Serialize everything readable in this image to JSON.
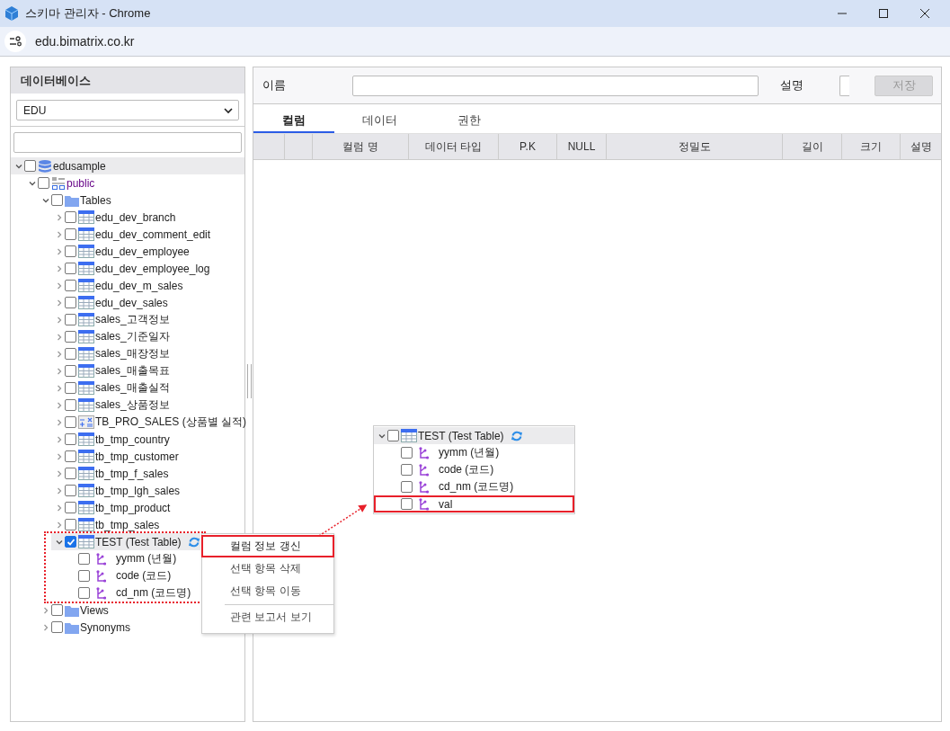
{
  "window": {
    "title": "스키마 관리자 - Chrome",
    "url": "edu.bimatrix.co.kr"
  },
  "sidebar": {
    "heading": "데이터베이스",
    "database_select": {
      "value": "EDU"
    },
    "tree": [
      {
        "label": "edusample",
        "kind": "database",
        "expanded": true,
        "checked": false,
        "highlighted": true,
        "children": [
          {
            "label": "public",
            "kind": "schema",
            "expanded": true,
            "checked": false,
            "highlighted": false,
            "children": [
              {
                "label": "Tables",
                "kind": "folder",
                "expanded": true,
                "checked": false,
                "highlighted": false,
                "children": [
                  {
                    "label": "edu_dev_branch",
                    "kind": "table",
                    "expanded": false,
                    "checked": false,
                    "highlighted": false
                  },
                  {
                    "label": "edu_dev_comment_edit",
                    "kind": "table",
                    "expanded": false,
                    "checked": false,
                    "highlighted": false
                  },
                  {
                    "label": "edu_dev_employee",
                    "kind": "table",
                    "expanded": false,
                    "checked": false,
                    "highlighted": false
                  },
                  {
                    "label": "edu_dev_employee_log",
                    "kind": "table",
                    "expanded": false,
                    "checked": false,
                    "highlighted": false
                  },
                  {
                    "label": "edu_dev_m_sales",
                    "kind": "table",
                    "expanded": false,
                    "checked": false,
                    "highlighted": false
                  },
                  {
                    "label": "edu_dev_sales",
                    "kind": "table",
                    "expanded": false,
                    "checked": false,
                    "highlighted": false
                  },
                  {
                    "label": "sales_고객정보",
                    "kind": "table",
                    "expanded": false,
                    "checked": false,
                    "highlighted": false
                  },
                  {
                    "label": "sales_기준일자",
                    "kind": "table",
                    "expanded": false,
                    "checked": false,
                    "highlighted": false
                  },
                  {
                    "label": "sales_매장정보",
                    "kind": "table",
                    "expanded": false,
                    "checked": false,
                    "highlighted": false
                  },
                  {
                    "label": "sales_매출목표",
                    "kind": "table",
                    "expanded": false,
                    "checked": false,
                    "highlighted": false
                  },
                  {
                    "label": "sales_매출실적",
                    "kind": "table",
                    "expanded": false,
                    "checked": false,
                    "highlighted": false
                  },
                  {
                    "label": "sales_상품정보",
                    "kind": "table",
                    "expanded": false,
                    "checked": false,
                    "highlighted": false
                  },
                  {
                    "label": "TB_PRO_SALES (상품별 실적)",
                    "kind": "view",
                    "expanded": false,
                    "checked": false,
                    "highlighted": false
                  },
                  {
                    "label": "tb_tmp_country",
                    "kind": "table",
                    "expanded": false,
                    "checked": false,
                    "highlighted": false
                  },
                  {
                    "label": "tb_tmp_customer",
                    "kind": "table",
                    "expanded": false,
                    "checked": false,
                    "highlighted": false
                  },
                  {
                    "label": "tb_tmp_f_sales",
                    "kind": "table",
                    "expanded": false,
                    "checked": false,
                    "highlighted": false
                  },
                  {
                    "label": "tb_tmp_lgh_sales",
                    "kind": "table",
                    "expanded": false,
                    "checked": false,
                    "highlighted": false
                  },
                  {
                    "label": "tb_tmp_product",
                    "kind": "table",
                    "expanded": false,
                    "checked": false,
                    "highlighted": false
                  },
                  {
                    "label": "tb_tmp_sales",
                    "kind": "table",
                    "expanded": false,
                    "checked": false,
                    "highlighted": false
                  },
                  {
                    "label": "TEST (Test Table)",
                    "kind": "table",
                    "expanded": true,
                    "checked": true,
                    "highlighted": true,
                    "refresh": true,
                    "annotated": true,
                    "children": [
                      {
                        "label": "yymm (년월)",
                        "kind": "column",
                        "checked": false,
                        "highlighted": false
                      },
                      {
                        "label": "code (코드)",
                        "kind": "column",
                        "checked": false,
                        "highlighted": false
                      },
                      {
                        "label": "cd_nm (코드명)",
                        "kind": "column",
                        "checked": false,
                        "highlighted": false
                      }
                    ]
                  }
                ]
              },
              {
                "label": "Views",
                "kind": "folder",
                "expanded": false,
                "checked": false,
                "highlighted": false
              },
              {
                "label": "Synonyms",
                "kind": "folder",
                "expanded": false,
                "checked": false,
                "highlighted": false
              }
            ]
          }
        ]
      }
    ]
  },
  "detail": {
    "name_label": "이름",
    "description_label": "설명",
    "save_button": {
      "label": "저장",
      "disabled": true
    },
    "tabs": [
      {
        "label": "컬럼",
        "selected": true
      },
      {
        "label": "데이터",
        "selected": false
      },
      {
        "label": "권한",
        "selected": false
      }
    ],
    "table": {
      "columns": [
        "컬럼 명",
        "데이터 타입",
        "P.K",
        "NULL",
        "정밀도",
        "길이",
        "크기",
        "설명"
      ]
    }
  },
  "context_menu": {
    "items": [
      {
        "label": "컬럼 정보 갱신",
        "highlighted": true,
        "separator_before": false
      },
      {
        "label": "선택 항목 삭제",
        "highlighted": false,
        "separator_before": false
      },
      {
        "label": "선택 항목 이동",
        "highlighted": false,
        "separator_before": false
      },
      {
        "label": "관련 보고서 보기",
        "highlighted": false,
        "separator_before": true
      }
    ]
  },
  "callout": {
    "tree": [
      {
        "label": "TEST (Test Table)",
        "kind": "table",
        "expanded": true,
        "checked": false,
        "highlighted": true,
        "refresh": true,
        "children": [
          {
            "label": "yymm (년월)",
            "kind": "column",
            "checked": false,
            "highlighted": false
          },
          {
            "label": "code (코드)",
            "kind": "column",
            "checked": false,
            "highlighted": false
          },
          {
            "label": "cd_nm (코드명)",
            "kind": "column",
            "checked": false,
            "highlighted": false
          },
          {
            "label": "val",
            "kind": "column",
            "checked": false,
            "highlighted": false,
            "marked": true
          }
        ]
      }
    ]
  }
}
